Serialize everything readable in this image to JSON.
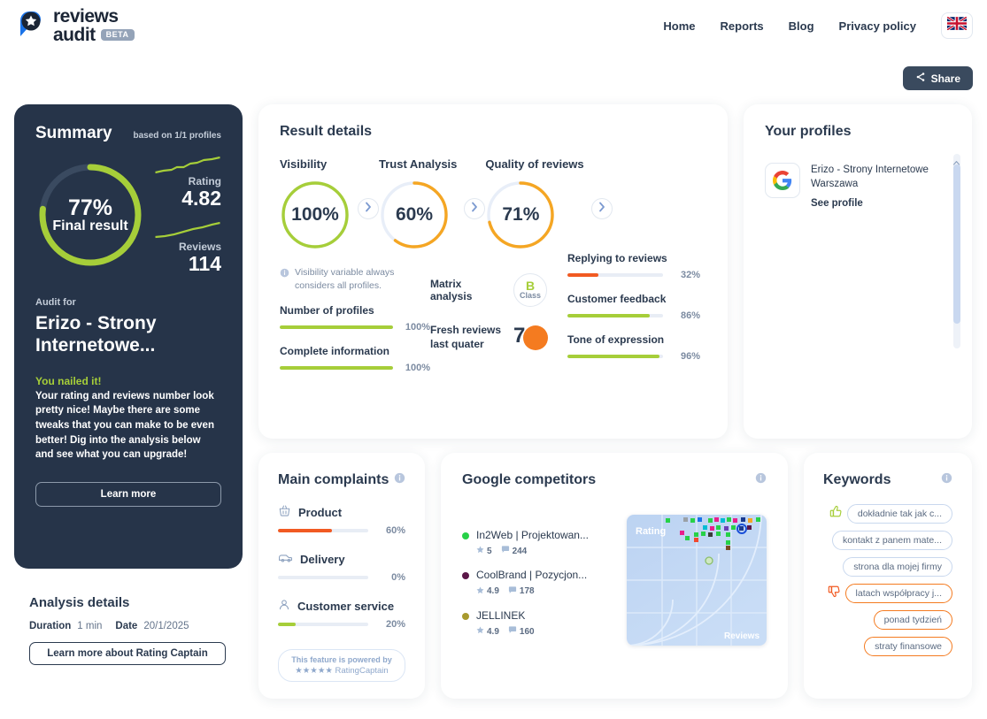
{
  "brand": {
    "logo_line1": "reviews",
    "logo_line2": "audit",
    "beta_label": "BETA",
    "accent_green": "#a6ce39",
    "accent_orange": "#f47b20",
    "dark_navy": "#263449",
    "blue": "#1a73e8"
  },
  "nav": {
    "items": [
      {
        "label": "Home"
      },
      {
        "label": "Reports"
      },
      {
        "label": "Blog"
      },
      {
        "label": "Privacy policy"
      }
    ],
    "language_flag": "uk-flag"
  },
  "share": {
    "label": "Share"
  },
  "summary": {
    "title": "Summary",
    "subtitle": "based on 1/1 profiles",
    "final_result_pct": 77,
    "final_result_value": "77%",
    "final_result_label": "Final result",
    "rating_label": "Rating",
    "rating_value": "4.82",
    "reviews_label": "Reviews",
    "reviews_value": "114",
    "audit_for_label": "Audit for",
    "audit_name": "Erizo - Strony Internetowe...",
    "verdict_title": "You nailed it!",
    "verdict_text": "Your rating and reviews number look pretty nice! Maybe there are some tweaks that you can make to be even better! Dig into the analysis below and see what you can upgrade!",
    "learn_more_label": "Learn more"
  },
  "analysis_details": {
    "title": "Analysis details",
    "duration_label": "Duration",
    "duration_value": "1 min",
    "date_label": "Date",
    "date_value": "20/1/2025",
    "button_label": "Learn more about Rating Captain"
  },
  "result_details": {
    "title": "Result details",
    "gauges": [
      {
        "label": "Visibility",
        "value": "100%",
        "pct": 100,
        "color": "#a6ce39"
      },
      {
        "label": "Trust Analysis",
        "value": "60%",
        "pct": 60,
        "color": "#f5a623"
      },
      {
        "label": "Quality of reviews",
        "value": "71%",
        "pct": 71,
        "color": "#f5a623"
      }
    ],
    "note": "Visibility variable always considers all profiles.",
    "visibility_metrics": [
      {
        "label": "Number of profiles",
        "value": "100%",
        "pct": 100,
        "color": "#a6ce39"
      },
      {
        "label": "Complete information",
        "value": "100%",
        "pct": 100,
        "color": "#a6ce39"
      }
    ],
    "trust_metrics": [
      {
        "label": "Matrix analysis",
        "badge_letter": "B",
        "badge_word": "Class"
      },
      {
        "label": "Fresh reviews last quater",
        "pie_value": "7"
      }
    ],
    "quality_metrics": [
      {
        "label": "Replying to reviews",
        "value": "32%",
        "pct": 32,
        "color": "#f15a22"
      },
      {
        "label": "Customer feedback",
        "value": "86%",
        "pct": 86,
        "color": "#a6ce39"
      },
      {
        "label": "Tone of expression",
        "value": "96%",
        "pct": 96,
        "color": "#a6ce39"
      }
    ]
  },
  "profiles": {
    "title": "Your profiles",
    "items": [
      {
        "icon": "google-icon",
        "name": "Erizo - Strony Internetowe Warszawa",
        "link_label": "See profile"
      }
    ]
  },
  "complaints": {
    "title": "Main complaints",
    "items": [
      {
        "icon": "basket-icon",
        "label": "Product",
        "value": "60%",
        "pct": 60,
        "color": "#f15a22"
      },
      {
        "icon": "van-icon",
        "label": "Delivery",
        "value": "0%",
        "pct": 0,
        "color": "#a6ce39"
      },
      {
        "icon": "person-icon",
        "label": "Customer service",
        "value": "20%",
        "pct": 20,
        "color": "#a6ce39"
      }
    ],
    "powered_line1": "This feature is powered by",
    "powered_line2": "RatingCaptain",
    "powered_stars": "★★★★★"
  },
  "competitors": {
    "title": "Google competitors",
    "items": [
      {
        "name": "In2Web | Projektowan...",
        "rating": "5",
        "reviews": "244",
        "dot_color": "#27d148"
      },
      {
        "name": "CoolBrand | Pozycjon...",
        "rating": "4.9",
        "reviews": "178",
        "dot_color": "#5b1648"
      },
      {
        "name": "JELLINEK",
        "rating": "4.9",
        "reviews": "160",
        "dot_color": "#a89a2e"
      }
    ],
    "chart_axis_y": "Rating",
    "chart_axis_x": "Reviews"
  },
  "keywords": {
    "title": "Keywords",
    "items": [
      {
        "label": "dokładnie tak jak c...",
        "sentiment": "positive"
      },
      {
        "label": "kontakt z panem mate...",
        "sentiment": "neutral"
      },
      {
        "label": "strona dla mojej firmy",
        "sentiment": "neutral"
      },
      {
        "label": "latach współpracy j...",
        "sentiment": "negative"
      },
      {
        "label": "ponad tydzień",
        "sentiment": "negative"
      },
      {
        "label": "straty finansowe",
        "sentiment": "negative"
      }
    ]
  }
}
